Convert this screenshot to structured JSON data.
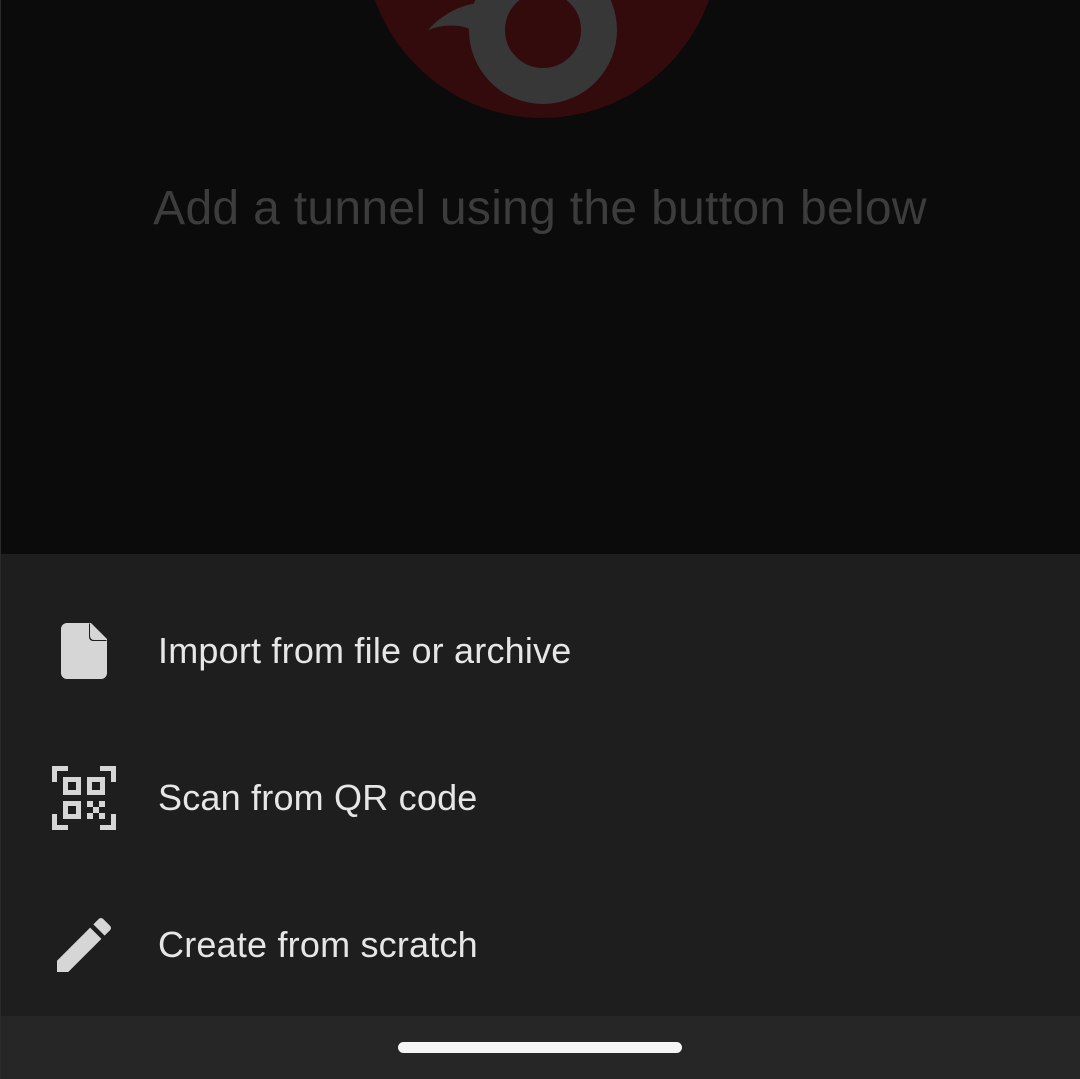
{
  "background": {
    "empty_message": "Add a tunnel using the button below",
    "logo_icon": "wireguard-logo-icon"
  },
  "bottom_sheet": {
    "items": [
      {
        "label": "Import from file or archive",
        "icon": "file-icon"
      },
      {
        "label": "Scan from QR code",
        "icon": "qr-code-scanner-icon"
      },
      {
        "label": "Create from scratch",
        "icon": "pencil-icon"
      }
    ]
  },
  "colors": {
    "scrim_background": "#0b0b0b",
    "sheet_background": "#1e1e1e",
    "text_primary": "#e6e6e6",
    "icon_color": "#d6d6d6",
    "logo_red": "#3a0b0c",
    "logo_gray": "#373737"
  }
}
